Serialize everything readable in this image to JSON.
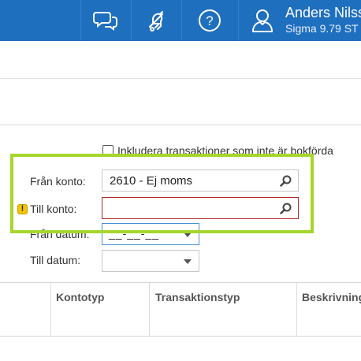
{
  "topbar": {
    "chat_icon": "chat-bubbles-icon",
    "notification_icon": "bell-icon",
    "help_icon": "help-icon",
    "user_name": "Anders Nilss",
    "user_org": "Sigma 9.79 ST"
  },
  "form": {
    "include_unposted_label": "Inkludera transaktioner som inte är bokförda",
    "from_account_label": "Från konto:",
    "from_account_value": "2610 - Ej moms",
    "to_account_label": "Till konto:",
    "to_account_value": "",
    "warning_icon": "warning-icon",
    "from_date_label": "Från datum:",
    "from_date_mask": "__-__-__",
    "to_date_label": "Till datum:",
    "to_date_value": ""
  },
  "table": {
    "columns": [
      "",
      "Kontotyp",
      "Transaktionstyp",
      "Beskrivning"
    ]
  },
  "colors": {
    "topbar": "#1f6fbf",
    "highlight": "#a6d62c",
    "error_border": "#b22a2a",
    "warning": "#f2c500"
  }
}
